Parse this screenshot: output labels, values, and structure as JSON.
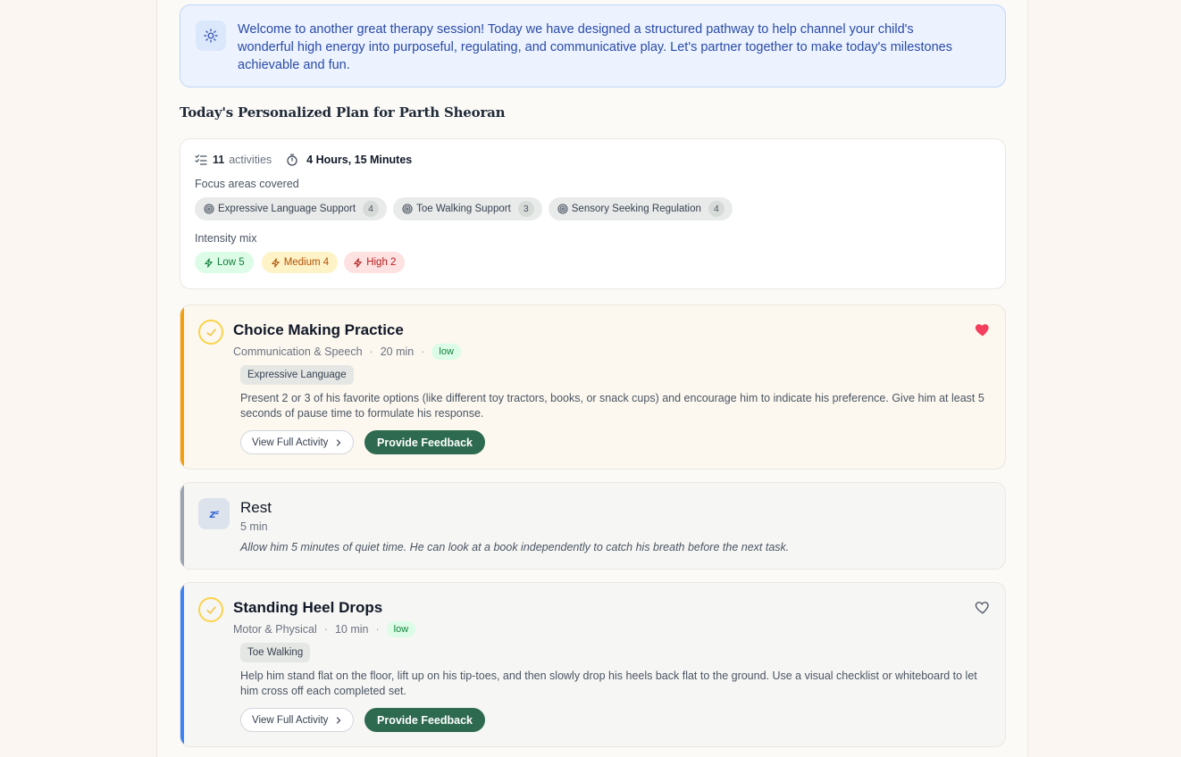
{
  "intro": {
    "message": "Welcome to another great therapy session! Today we have designed a structured pathway to help channel your child's wonderful high energy into purposeful, regulating, and communicative play. Let's partner together to make today's milestones achievable and fun.",
    "icon": "sun-icon"
  },
  "plan": {
    "title": "Today's Personalized Plan for Parth Sheoran",
    "activity_count": "11",
    "activity_label": "activities",
    "duration": "4 Hours, 15 Minutes",
    "focus_label": "Focus areas covered",
    "focus_areas": [
      {
        "label": "Expressive Language Support",
        "count": "4"
      },
      {
        "label": "Toe Walking Support",
        "count": "3"
      },
      {
        "label": "Sensory Seeking Regulation",
        "count": "4"
      }
    ],
    "intensity_label": "Intensity mix",
    "intensity": [
      {
        "label": "Low 5",
        "level": "low"
      },
      {
        "label": "Medium 4",
        "level": "medium"
      },
      {
        "label": "High 2",
        "level": "high"
      }
    ]
  },
  "activities": [
    {
      "title": "Choice Making Practice",
      "category": "Communication & Speech",
      "duration": "20 min",
      "intensity": "low",
      "tag": "Expressive Language",
      "description": "Present 2 or 3 of his favorite options (like different toy tractors, books, or snack cups) and encourage him to indicate his preference. Give him at least 5 seconds of pause time to formulate his response.",
      "view_label": "View Full Activity",
      "feedback_label": "Provide Feedback",
      "favorited": true,
      "accent": "#f59e0b"
    },
    {
      "title": "Standing Heel Drops",
      "category": "Motor & Physical",
      "duration": "10 min",
      "intensity": "low",
      "tag": "Toe Walking",
      "description": "Help him stand flat on the floor, lift up on his tip-toes, and then slowly drop his heels back flat to the ground. Use a visual checklist or whiteboard to let him cross off each completed set.",
      "view_label": "View Full Activity",
      "feedback_label": "Provide Feedback",
      "favorited": false,
      "accent": "#3b82f6"
    }
  ],
  "rest": {
    "title": "Rest",
    "duration": "5 min",
    "note": "Allow him 5 minutes of quiet time. He can look at a book independently to catch his breath before the next task.",
    "icon": "zzz-icon"
  },
  "colors": {
    "brand_green": "#2d6a4f",
    "favorite_red": "#f43f5e",
    "intro_blue": "#2a4aa8"
  }
}
